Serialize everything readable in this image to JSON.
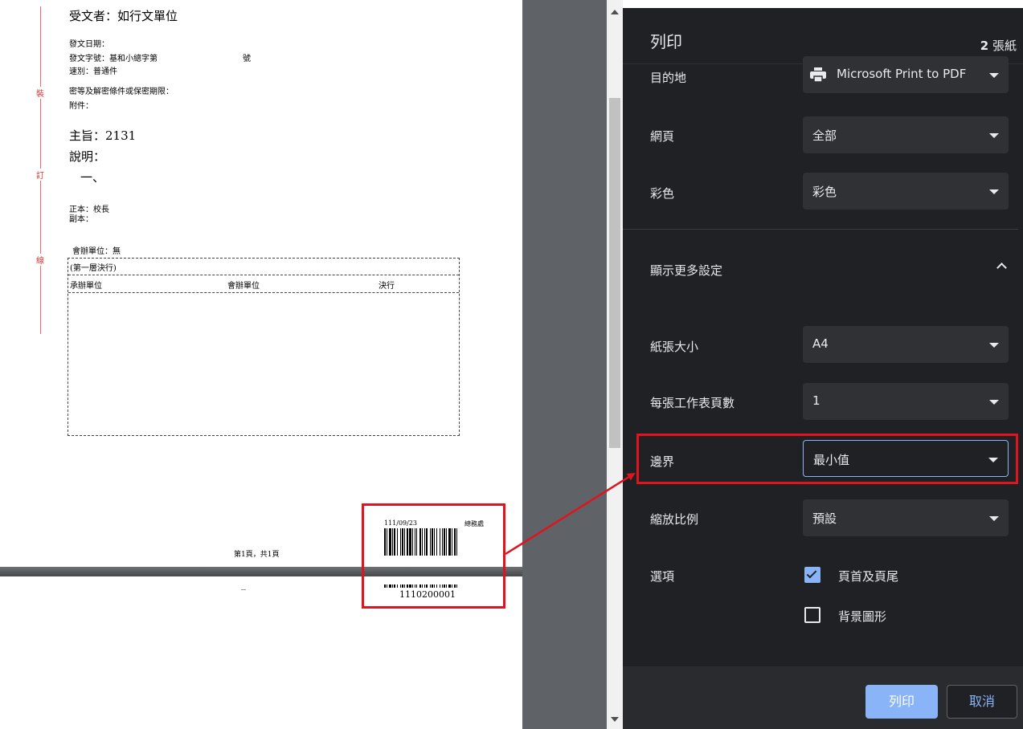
{
  "preview": {
    "recipient": "受文者：如行文單位",
    "date": "發文日期：",
    "ref_no": "發文字號：基和小總字第",
    "ref_suffix": "號",
    "speed": "速別：普通件",
    "secrecy": "密等及解密條件或保密期限：",
    "attachments": "附件：",
    "subject": "主旨：2131",
    "description": "說明：",
    "item_one": "一、",
    "main_recipient": "正本：校長",
    "copy_recipient": "副本：",
    "co_unit": "會辦單位：無",
    "table_title": "(第一層決行)",
    "table_headers": [
      "承辦單位",
      "會辦單位",
      "決行"
    ],
    "binding_chars": [
      "裝",
      "訂",
      "線"
    ],
    "page_footer": "第1頁，共1頁",
    "barcode_date": "111/09/23",
    "barcode_office": "總務處",
    "barcode_number": "1110200001"
  },
  "dialog": {
    "title": "列印",
    "sheet_count": "2",
    "sheet_unit": "張紙",
    "rows": {
      "destination": {
        "label": "目的地",
        "value": "Microsoft Print to PDF"
      },
      "pages": {
        "label": "網頁",
        "value": "全部"
      },
      "color": {
        "label": "彩色",
        "value": "彩色"
      },
      "more_settings": "顯示更多設定",
      "paper_size": {
        "label": "紙張大小",
        "value": "A4"
      },
      "pages_per_sheet": {
        "label": "每張工作表頁數",
        "value": "1"
      },
      "margins": {
        "label": "邊界",
        "value": "最小值"
      },
      "scale": {
        "label": "縮放比例",
        "value": "預設"
      },
      "options": {
        "label": "選項"
      }
    },
    "options": {
      "headers_footers": {
        "label": "頁首及頁尾",
        "checked": true
      },
      "background_graphics": {
        "label": "背景圖形",
        "checked": false
      }
    },
    "print_button": "列印",
    "cancel_button": "取消"
  },
  "colors": {
    "highlight": "#e0141e",
    "accent": "#8ab4f8",
    "dialog_bg": "#202124"
  }
}
